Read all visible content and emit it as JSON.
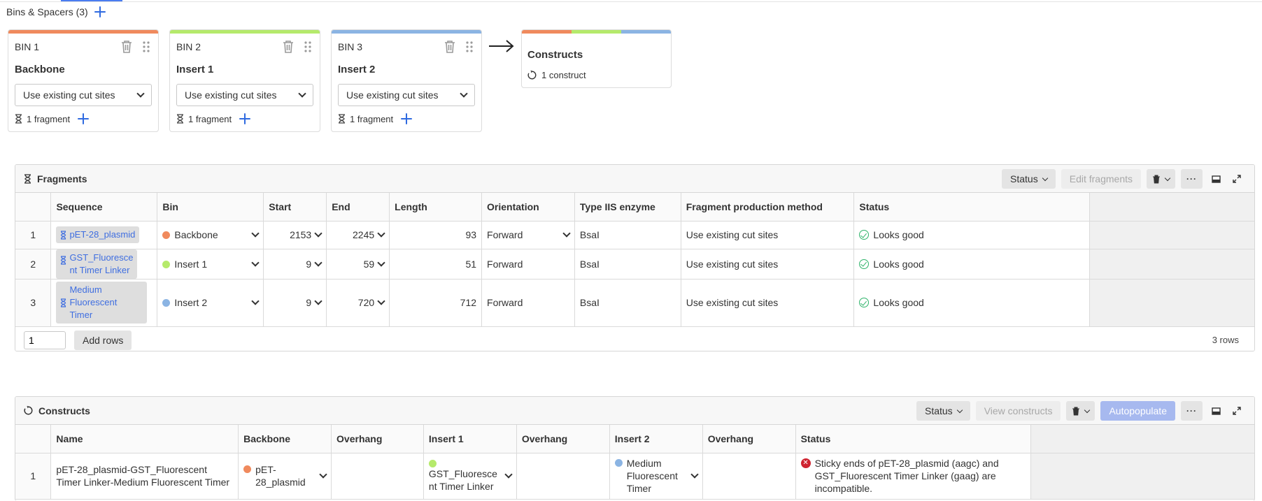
{
  "bins_header": {
    "label": "Bins & Spacers (3)"
  },
  "bins": [
    {
      "title": "BIN 1",
      "name": "Backbone",
      "method": "Use existing cut sites",
      "fragments": "1 fragment",
      "color": "#f08a5d"
    },
    {
      "title": "BIN 2",
      "name": "Insert 1",
      "method": "Use existing cut sites",
      "fragments": "1 fragment",
      "color": "#b5ea6b"
    },
    {
      "title": "BIN 3",
      "name": "Insert 2",
      "method": "Use existing cut sites",
      "fragments": "1 fragment",
      "color": "#8bb4e3"
    }
  ],
  "constructs_card": {
    "title": "Constructs",
    "count": "1 construct"
  },
  "fragments": {
    "title": "Fragments",
    "status_button": "Status",
    "edit_button": "Edit fragments",
    "columns": [
      "Sequence",
      "Bin",
      "Start",
      "End",
      "Length",
      "Orientation",
      "Type IIS enzyme",
      "Fragment production method",
      "Status"
    ],
    "rows": [
      {
        "idx": "1",
        "sequence": "pET-28_plasmid",
        "bin": "Backbone",
        "bin_color": "#f08a5d",
        "start": "2153",
        "end": "2245",
        "length": "93",
        "orientation": "Forward",
        "enzyme": "BsaI",
        "method": "Use existing cut sites",
        "status": "Looks good"
      },
      {
        "idx": "2",
        "sequence": "GST_Fluoresce\nnt Timer Linker",
        "bin": "Insert 1",
        "bin_color": "#b5ea6b",
        "start": "9",
        "end": "59",
        "length": "51",
        "orientation": "Forward",
        "enzyme": "BsaI",
        "method": "Use existing cut sites",
        "status": "Looks good"
      },
      {
        "idx": "3",
        "sequence": "Medium\nFluorescent\nTimer",
        "bin": "Insert 2",
        "bin_color": "#8bb4e3",
        "start": "9",
        "end": "720",
        "length": "712",
        "orientation": "Forward",
        "enzyme": "BsaI",
        "method": "Use existing cut sites",
        "status": "Looks good"
      }
    ],
    "add_rows_value": "1",
    "add_rows_button": "Add rows",
    "row_count": "3 rows"
  },
  "constructs": {
    "title": "Constructs",
    "status_button": "Status",
    "view_button": "View constructs",
    "autopopulate_button": "Autopopulate",
    "columns": [
      "Name",
      "Backbone",
      "Overhang",
      "Insert 1",
      "Overhang",
      "Insert 2",
      "Overhang",
      "Status"
    ],
    "rows": [
      {
        "idx": "1",
        "name": "pET-28_plasmid-GST_Fluorescent Timer Linker-Medium Fluorescent Timer",
        "backbone": "pET-\n28_plasmid",
        "backbone_color": "#f08a5d",
        "insert1": "GST_Fluoresce\nnt Timer Linker",
        "insert1_color": "#b5ea6b",
        "insert2": "Medium\nFluorescent\nTimer",
        "insert2_color": "#8bb4e3",
        "status": "Sticky ends of pET-28_plasmid (aagc) and GST_Fluorescent Timer Linker (gaag) are incompatible."
      }
    ]
  }
}
